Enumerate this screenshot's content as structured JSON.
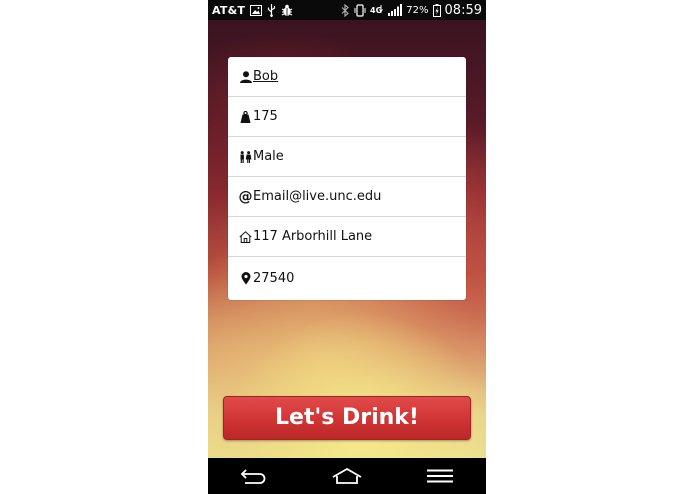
{
  "status_bar": {
    "carrier": "AT&T",
    "battery_percent": "72%",
    "time": "08:59",
    "left_icons": [
      "gallery-icon",
      "usb-icon",
      "debug-bug-icon"
    ],
    "right_icons": [
      "bluetooth-icon",
      "vibrate-icon",
      "data-4g-icon",
      "signal-icon",
      "battery-icon"
    ]
  },
  "profile": {
    "rows": [
      {
        "icon": "person-icon",
        "value": "Bob"
      },
      {
        "icon": "weight-icon",
        "value": "175"
      },
      {
        "icon": "gender-icon",
        "value": "Male"
      },
      {
        "icon": "at-icon",
        "value": "Email@live.unc.edu"
      },
      {
        "icon": "home-icon",
        "value": "117 Arborhill Lane"
      },
      {
        "icon": "location-pin-icon",
        "value": "27540"
      }
    ]
  },
  "primary_action": {
    "label": "Let's Drink!",
    "color": "#d43838"
  },
  "nav_bar": {
    "buttons": [
      "back-icon",
      "home-nav-icon",
      "menu-icon"
    ]
  }
}
